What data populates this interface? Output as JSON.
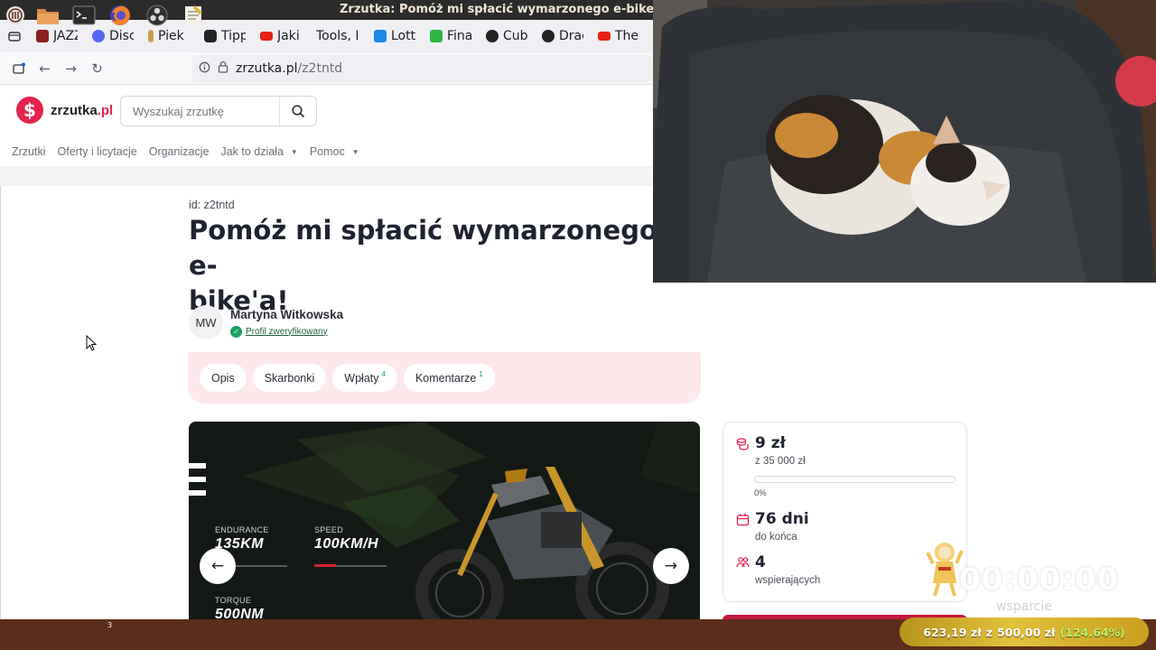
{
  "window": {
    "title": "Zrzutka: Pomóż mi spłacić wymarzonego e-bike'a! | Martyn"
  },
  "browser": {
    "tabs": [
      {
        "label": "JAZZ",
        "icon": "jazz-favicon",
        "color": "#8b1e1e"
      },
      {
        "label": "Disc",
        "icon": "discord-favicon",
        "color": "#5865f2"
      },
      {
        "label": "Piek",
        "icon": "page-favicon",
        "color": "#c9a14a"
      },
      {
        "label": "Tipp",
        "icon": "tipply-favicon",
        "color": "#222222"
      },
      {
        "label": "Jaki",
        "icon": "youtube-favicon",
        "color": "#e62117"
      },
      {
        "label": "Tools, I",
        "icon": "blank-favicon",
        "color": ""
      },
      {
        "label": "Lott",
        "icon": "lotto-favicon",
        "color": "#1e88e5"
      },
      {
        "label": "Fina",
        "icon": "finance-favicon",
        "color": "#2fb344"
      },
      {
        "label": "Cub",
        "icon": "cube-favicon",
        "color": "#222222"
      },
      {
        "label": "Drac",
        "icon": "dracula-favicon",
        "color": "#222222"
      },
      {
        "label": "The",
        "icon": "youtube-favicon",
        "color": "#e62117"
      }
    ],
    "url": {
      "host": "zrzutka.pl",
      "path": "/z2tntd"
    }
  },
  "site": {
    "logo_text": "zrzutka",
    "logo_tld": ".pl",
    "search": {
      "placeholder": "Wyszukaj zrzutkę"
    },
    "nav": [
      {
        "label": "Zrzutki",
        "dropdown": false
      },
      {
        "label": "Oferty i licytacje",
        "dropdown": false
      },
      {
        "label": "Organizacje",
        "dropdown": false
      },
      {
        "label": "Jak to działa",
        "dropdown": true
      },
      {
        "label": "Pomoc",
        "dropdown": true
      }
    ]
  },
  "campaign": {
    "id_label": "id: z2tntd",
    "title_line1": "Pomóż mi spłacić wymarzonego e-",
    "title_line2": "bike'a!",
    "author": {
      "initials": "MW",
      "name": "Martyna Witkowska",
      "verified_label": "Profil zweryfikowany"
    },
    "tabs": [
      {
        "label": "Opis",
        "count": ""
      },
      {
        "label": "Skarbonki",
        "count": ""
      },
      {
        "label": "Wpłaty",
        "count": "4"
      },
      {
        "label": "Komentarze",
        "count": "1"
      }
    ],
    "hero": {
      "specs": [
        {
          "label": "ENDURANCE",
          "value": "135KM"
        },
        {
          "label": "SPEED",
          "value": "100KM/H"
        },
        {
          "label": "TORQUE",
          "value": "500NM"
        }
      ]
    },
    "stats": {
      "raised": "9 zł",
      "goal": "z 35 000 zł",
      "progress_fraction": 0.0,
      "progress_label": "0%",
      "days": "76 dni",
      "days_label": "do końca",
      "supporters": "4",
      "supporters_label": "wspierających"
    }
  },
  "stream_overlay": {
    "timer": "00:00:00",
    "caption": "wsparcie",
    "donation_amount": "623,19 zł",
    "donation_sep": "z",
    "donation_goal": "500,00 zł",
    "donation_pct": "(124.64%)"
  },
  "taskbar": {
    "items": [
      {
        "icon": "start-menu-icon"
      },
      {
        "icon": "file-manager-icon"
      },
      {
        "icon": "terminal-icon"
      },
      {
        "icon": "firefox-icon",
        "badge": "3"
      },
      {
        "icon": "obs-icon"
      },
      {
        "icon": "text-editor-icon"
      }
    ]
  },
  "colors": {
    "brand": "#e4234f",
    "tabs_panel_bg": "#fde8ec",
    "verified": "#1aa260",
    "taskbar": "#5b2d1b",
    "donation_bar": "#d4b02c"
  }
}
